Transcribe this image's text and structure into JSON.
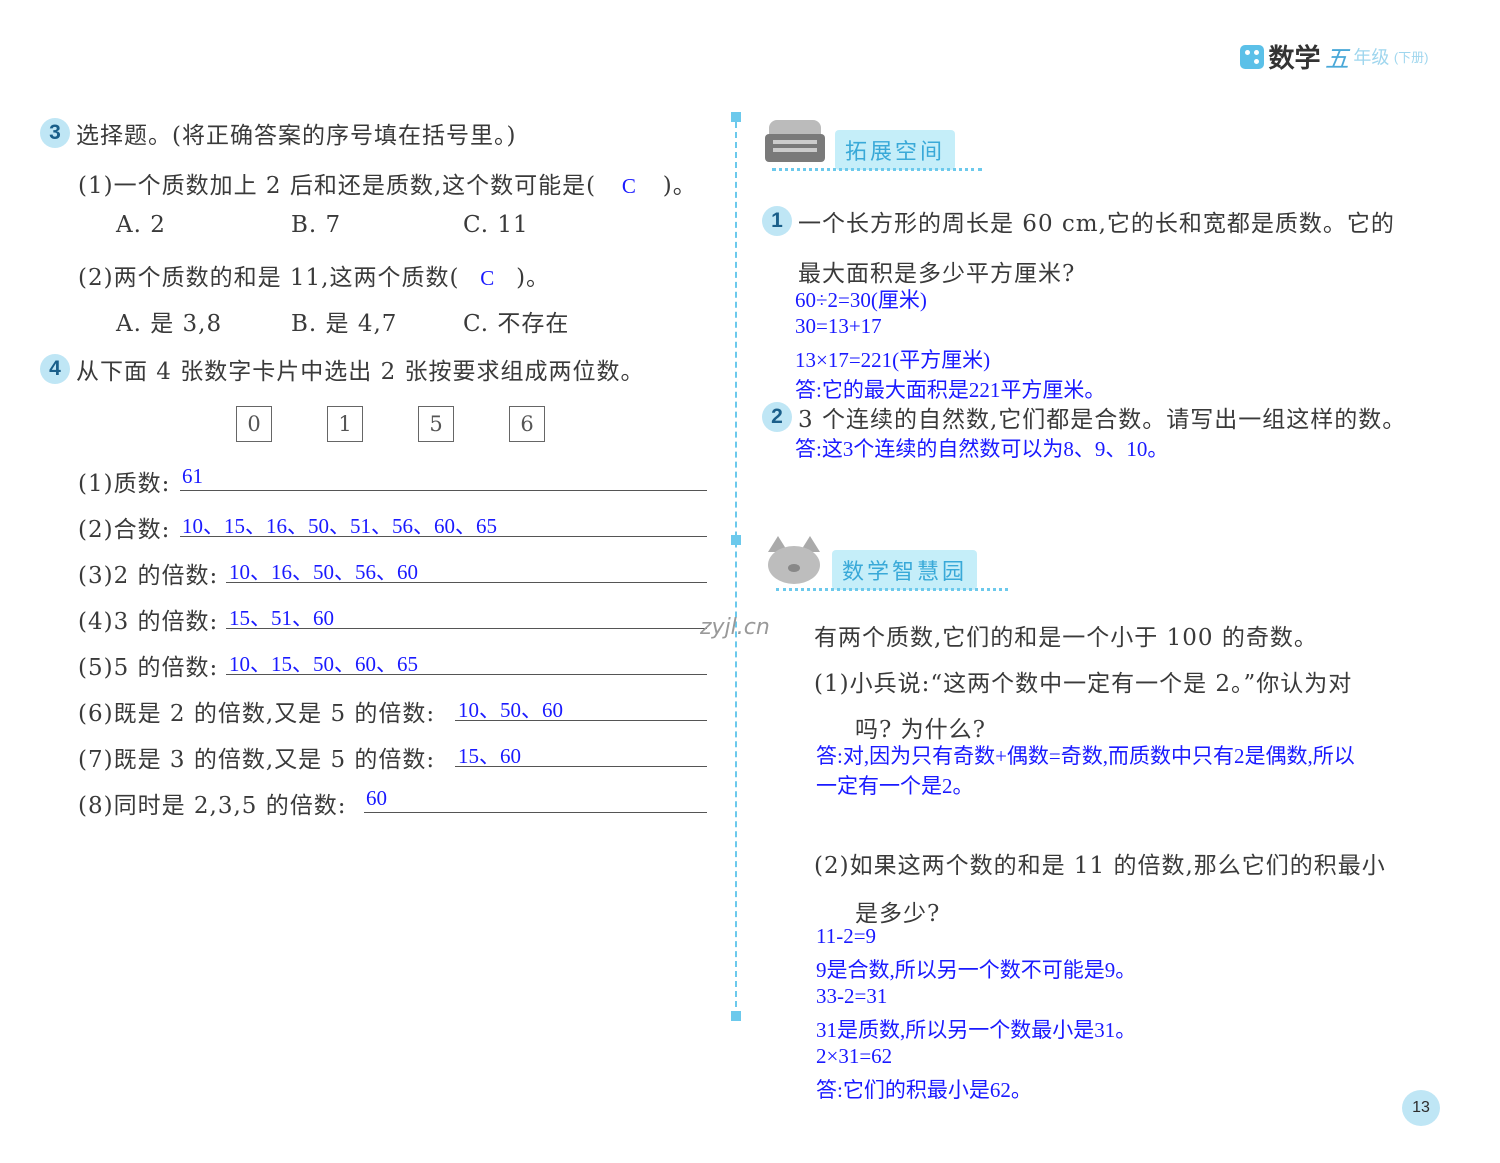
{
  "header": {
    "subject": "数学",
    "grade": "五",
    "grade_suffix": "年级",
    "volume": "(下册)"
  },
  "page_number": "13",
  "watermark": "zyjl.cn",
  "q3": {
    "number": "3",
    "title": "选择题。(将正确答案的序号填在括号里。)",
    "p1": {
      "stem": "(1)一个质数加上 2 后和还是质数,这个数可能是(",
      "answer": "C",
      "close": ")。",
      "options": [
        "A. 2",
        "B. 7",
        "C. 11"
      ]
    },
    "p2": {
      "stem": "(2)两个质数的和是 11,这两个质数(",
      "answer": "C",
      "close": ")。",
      "options": [
        "A. 是 3,8",
        "B. 是 4,7",
        "C. 不存在"
      ]
    }
  },
  "q4": {
    "number": "4",
    "title": "从下面 4 张数字卡片中选出 2 张按要求组成两位数。",
    "cards": [
      "0",
      "1",
      "5",
      "6"
    ],
    "items": [
      {
        "label": "(1)质数:",
        "answer": "61"
      },
      {
        "label": "(2)合数:",
        "answer": "10、15、16、50、51、56、60、65"
      },
      {
        "label": "(3)2 的倍数:",
        "answer": "10、16、50、56、60"
      },
      {
        "label": "(4)3 的倍数:",
        "answer": "15、51、60"
      },
      {
        "label": "(5)5 的倍数:",
        "answer": "10、15、50、60、65"
      },
      {
        "label": "(6)既是 2 的倍数,又是 5 的倍数:",
        "answer": "10、50、60"
      },
      {
        "label": "(7)既是 3 的倍数,又是 5 的倍数:",
        "answer": "15、60"
      },
      {
        "label": "(8)同时是 2,3,5 的倍数:",
        "answer": "60"
      }
    ]
  },
  "extension": {
    "label": "拓展空间",
    "q1": {
      "number": "1",
      "line1": "一个长方形的周长是 60 cm,它的长和宽都是质数。它的",
      "line2": "最大面积是多少平方厘米?",
      "answers": [
        "60÷2=30(厘米)",
        "30=13+17",
        "13×17=221(平方厘米)",
        "答:它的最大面积是221平方厘米。"
      ]
    },
    "q2": {
      "number": "2",
      "text": "3 个连续的自然数,它们都是合数。请写出一组这样的数。",
      "answer": "答:这3个连续的自然数可以为8、9、10。"
    }
  },
  "wisdom": {
    "label": "数学智慧园",
    "intro": "有两个质数,它们的和是一个小于 100 的奇数。",
    "p1": {
      "line1": "(1)小兵说:“这两个数中一定有一个是 2。”你认为对",
      "line2": "吗? 为什么?",
      "answers": [
        "答:对,因为只有奇数+偶数=奇数,而质数中只有2是偶数,所以",
        "一定有一个是2。"
      ]
    },
    "p2": {
      "line1": "(2)如果这两个数的和是 11 的倍数,那么它们的积最小",
      "line2": "是多少?",
      "answers": [
        "11-2=9",
        "9是合数,所以另一个数不可能是9。",
        "33-2=31",
        "31是质数,所以另一个数最小是31。",
        "2×31=62",
        "答:它们的积最小是62。"
      ]
    }
  }
}
